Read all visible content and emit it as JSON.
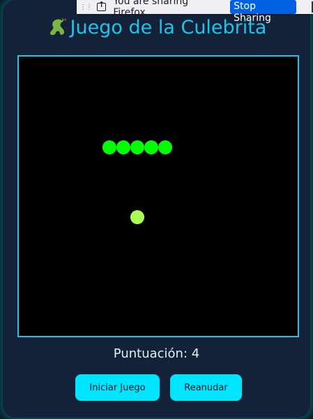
{
  "sharing_bar": {
    "message": "You are sharing Firefox.",
    "stop_label": "Stop Sharing"
  },
  "game": {
    "title": "Juego de la Culebrita",
    "title_icon": "snake-icon",
    "score_label": "Puntuación:",
    "score": 4,
    "score_text": "Puntuación: 4",
    "grid_cells": 20,
    "snake": [
      [
        6,
        6
      ],
      [
        7,
        6
      ],
      [
        8,
        6
      ],
      [
        9,
        6
      ],
      [
        10,
        6
      ]
    ],
    "food": [
      8,
      11
    ],
    "colors": {
      "accent": "#1ec4ea",
      "snake": "#00ff00",
      "food": "#aaff55",
      "board": "#000000",
      "button": "#00e5ff"
    }
  },
  "controls": {
    "start_label": "Iniciar Juego",
    "resume_label": "Reanudar"
  }
}
